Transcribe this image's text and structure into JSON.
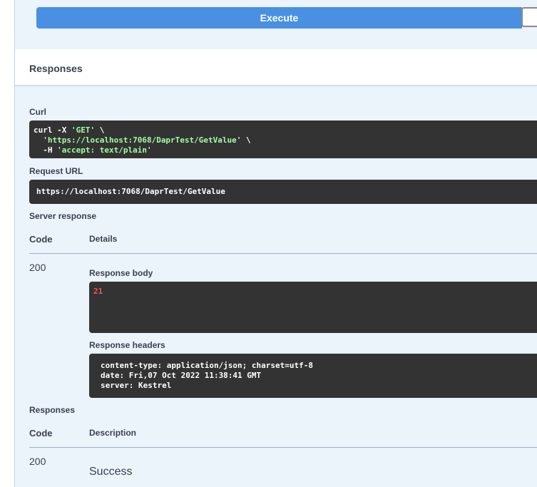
{
  "execute": {
    "label": "Execute"
  },
  "responses_section": {
    "title": "Responses"
  },
  "curl": {
    "label": "Curl",
    "cmd1": "curl -X ",
    "method": "'GET'",
    "cont1": " \\",
    "url": "'https://localhost:7068/DaprTest/GetValue'",
    "cont2": " \\",
    "h_flag": "-H ",
    "header": "'accept: text/plain'"
  },
  "request_url": {
    "label": "Request URL",
    "value": "https://localhost:7068/DaprTest/GetValue"
  },
  "server_response": {
    "label": "Server response",
    "col_code": "Code",
    "col_details": "Details",
    "status": "200",
    "body_label": "Response body",
    "body": "21",
    "headers_label": "Response headers",
    "headers": [
      "content-type: application/json; charset=utf-8",
      "date: Fri,07 Oct 2022 11:38:41 GMT",
      "server: Kestrel"
    ]
  },
  "responses_table": {
    "label": "Responses",
    "col_code": "Code",
    "col_description": "Description",
    "status": "200",
    "description": "Success"
  }
}
